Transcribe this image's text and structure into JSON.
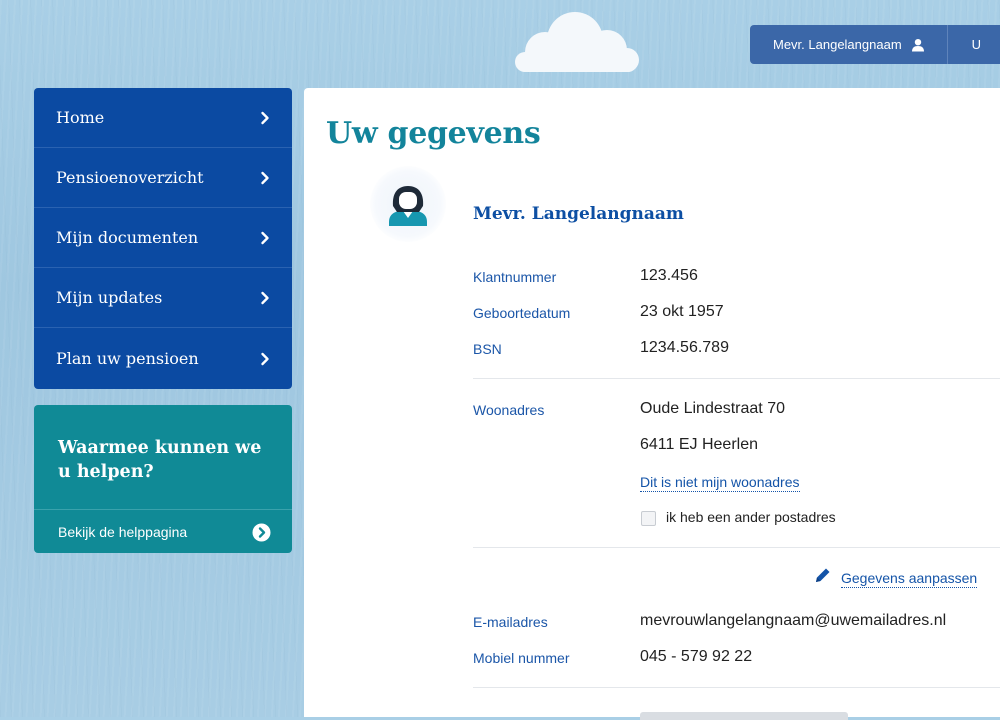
{
  "header": {
    "user_name": "Mevr. Langelangnaam",
    "next_button_label": "U"
  },
  "nav": {
    "items": [
      {
        "label": "Home"
      },
      {
        "label": "Pensioenoverzicht"
      },
      {
        "label": "Mijn documenten"
      },
      {
        "label": "Mijn updates"
      },
      {
        "label": "Plan uw pensioen"
      }
    ]
  },
  "help": {
    "title": "Waarmee kunnen we u helpen?",
    "link_label": "Bekijk de helppagina"
  },
  "main": {
    "title": "Uw gegevens",
    "profile_name": "Mevr. Langelangnaam",
    "fields": {
      "klantnummer": {
        "label": "Klantnummer",
        "value": "123.456"
      },
      "geboortedatum": {
        "label": "Geboortedatum",
        "value": "23 okt 1957"
      },
      "bsn": {
        "label": "BSN",
        "value": "1234.56.789"
      },
      "woonadres": {
        "label": "Woonadres",
        "line1": "Oude Lindestraat 70",
        "line2": "6411 EJ Heerlen"
      },
      "email": {
        "label": "E-mailadres",
        "value": "mevrouwlangelangnaam@uwemailadres.nl"
      },
      "mobiel": {
        "label": "Mobiel nummer",
        "value": "045 - 579 92 22"
      }
    },
    "not_my_address_link": "Dit is niet mijn woonadres",
    "other_postal_checkbox": {
      "label": "ik heb een ander postadres",
      "checked": false
    },
    "edit_link": "Gegevens aanpassen"
  },
  "colors": {
    "nav_bg": "#0b4aa2",
    "help_bg": "#108a96",
    "title": "#13849b",
    "label": "#1b56a8",
    "user_bar": "#3b67a8"
  }
}
